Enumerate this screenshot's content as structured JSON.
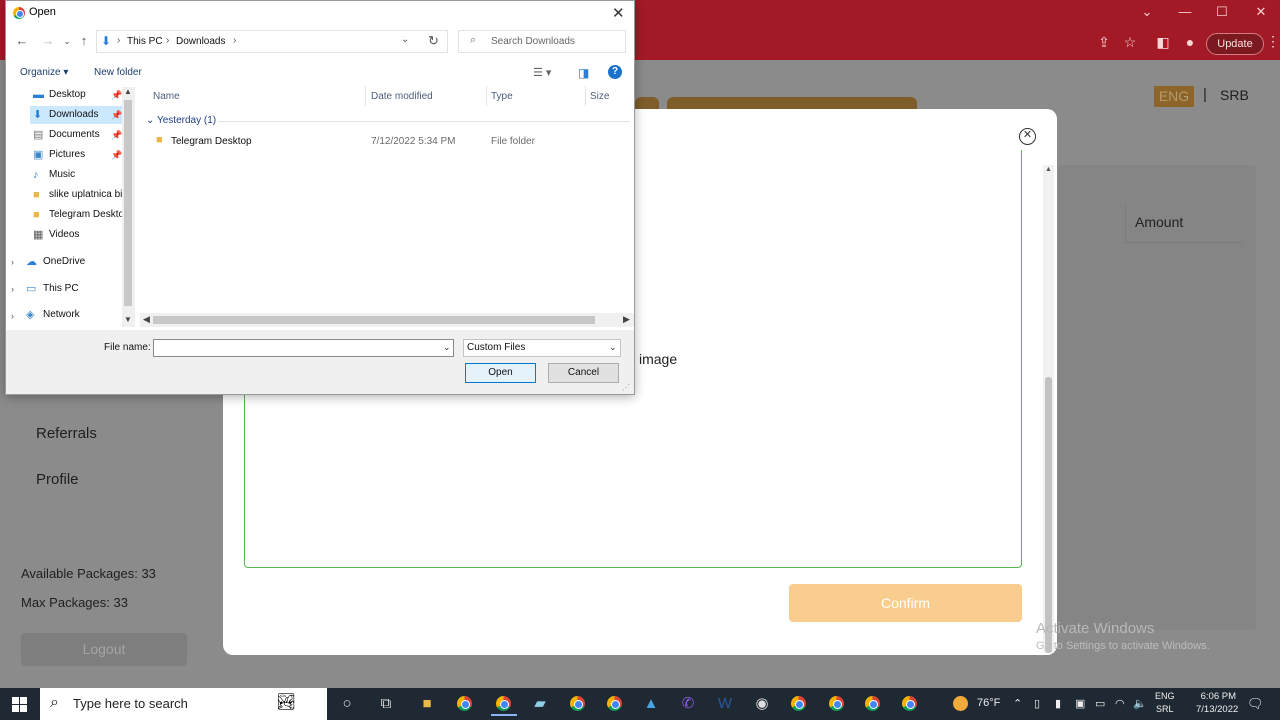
{
  "browser": {
    "update_label": "Update"
  },
  "sidebar": {
    "referrals": "Referrals",
    "profile": "Profile",
    "available_packages": "Available Packages: 33",
    "max_packages": "Max Packages: 33",
    "logout": "Logout"
  },
  "header": {
    "lang_eng": "ENG",
    "lang_sep": "|",
    "lang_srb": "SRB"
  },
  "background_card": {
    "amount_header": "Amount"
  },
  "modal": {
    "upload_text": "image",
    "confirm_label": "Confirm",
    "activate_title": "Activate Windows",
    "activate_sub": "Go to Settings to activate Windows."
  },
  "dialog": {
    "title": "Open",
    "breadcrumbs": [
      "This PC",
      "Downloads"
    ],
    "search_placeholder": "Search Downloads",
    "toolbar": {
      "organize": "Organize ▾",
      "new_folder": "New folder"
    },
    "nav_items": [
      {
        "label": "Desktop",
        "icon": "desktop-icon"
      },
      {
        "label": "Downloads",
        "icon": "downloads-icon"
      },
      {
        "label": "Documents",
        "icon": "documents-icon"
      },
      {
        "label": "Pictures",
        "icon": "pictures-icon"
      },
      {
        "label": "Music",
        "icon": "music-icon"
      },
      {
        "label": "slike uplatnica bi",
        "icon": "folder-icon"
      },
      {
        "label": "Telegram Deskto",
        "icon": "folder-icon"
      },
      {
        "label": "Videos",
        "icon": "videos-icon"
      }
    ],
    "nav_roots": [
      {
        "label": "OneDrive",
        "icon": "onedrive-icon"
      },
      {
        "label": "This PC",
        "icon": "this-pc-icon"
      },
      {
        "label": "Network",
        "icon": "network-icon"
      }
    ],
    "columns": {
      "name": "Name",
      "date": "Date modified",
      "type": "Type",
      "size": "Size"
    },
    "group_label": "Yesterday (1)",
    "files": [
      {
        "name": "Telegram Desktop",
        "date": "7/12/2022 5:34 PM",
        "type": "File folder",
        "size": ""
      }
    ],
    "file_name_label": "File name:",
    "file_name_value": "",
    "filter_value": "Custom Files",
    "open_label": "Open",
    "cancel_label": "Cancel"
  },
  "taskbar": {
    "search_text": "Type here to search",
    "weather": "76°F",
    "lang_top": "ENG",
    "lang_bottom": "SRL",
    "time": "6:06 PM",
    "date": "7/13/2022"
  }
}
